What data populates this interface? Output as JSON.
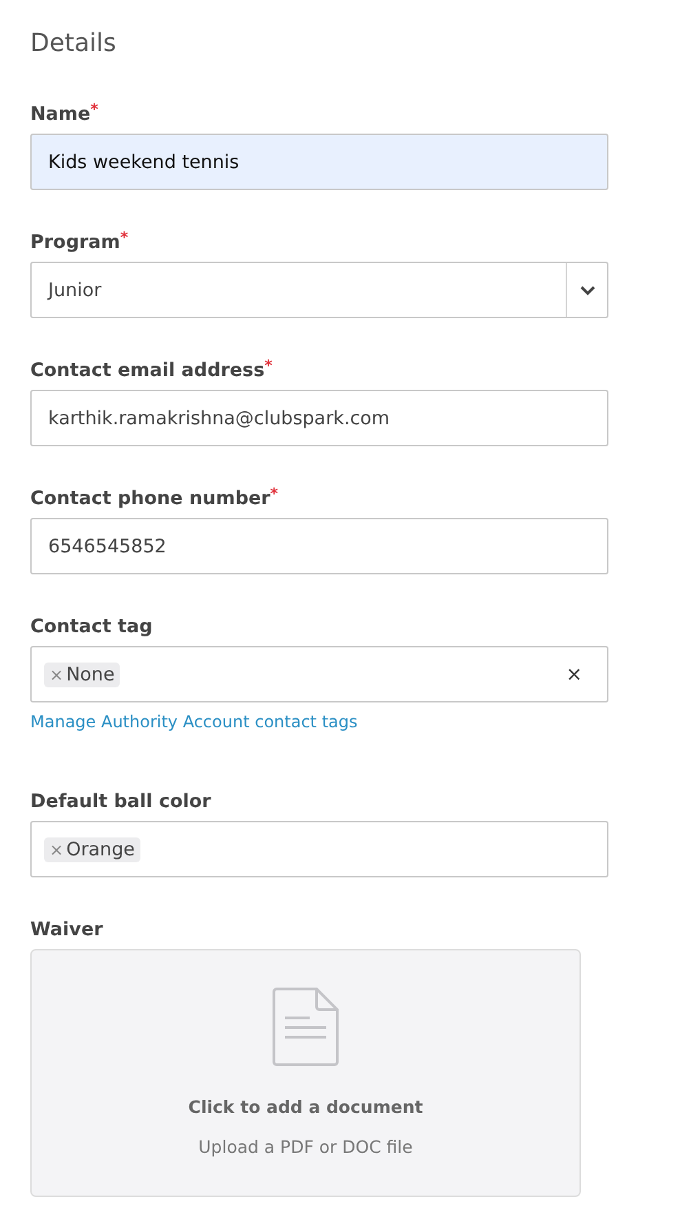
{
  "title": "Details",
  "fields": [
    {
      "kind": "text",
      "label": "Name",
      "required_mark": "*",
      "value": "Kids weekend tennis",
      "autofilled": true
    },
    {
      "kind": "select",
      "label": "Program",
      "required_mark": "*",
      "value": "Junior"
    },
    {
      "kind": "text",
      "label": "Contact email address",
      "required_mark": "*",
      "value": "karthik.ramakrishna@clubspark.com",
      "autofilled": false
    },
    {
      "kind": "text",
      "label": "Contact phone number",
      "required_mark": "*",
      "value": "6546545852",
      "autofilled": false
    },
    {
      "kind": "tags",
      "label": "Contact tag",
      "tags": [
        {
          "label": "None",
          "remove": "×"
        }
      ],
      "clear": "×",
      "link": "Manage Authority Account contact tags"
    },
    {
      "kind": "tags",
      "label": "Default ball color",
      "tags": [
        {
          "label": "Orange",
          "remove": "×"
        }
      ]
    },
    {
      "kind": "upload",
      "label": "Waiver",
      "heading": "Click to add a document",
      "hint": "Upload a PDF or DOC file"
    }
  ]
}
